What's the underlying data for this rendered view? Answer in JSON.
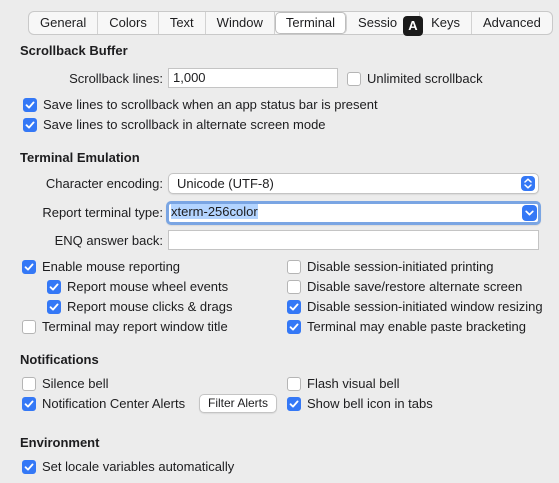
{
  "tabs": [
    "General",
    "Colors",
    "Text",
    "Window",
    "Terminal",
    "Sessio",
    "Keys",
    "Advanced"
  ],
  "active_tab": "Terminal",
  "tab_badge": "A",
  "scrollback": {
    "title": "Scrollback Buffer",
    "lines_label": "Scrollback lines:",
    "lines_value": "1,000",
    "unlimited_label": "Unlimited scrollback",
    "unlimited_checked": false,
    "status_bar_label": "Save lines to scrollback when an app status bar is present",
    "status_bar_checked": true,
    "alternate_label": "Save lines to scrollback in alternate screen mode",
    "alternate_checked": true
  },
  "emulation": {
    "title": "Terminal Emulation",
    "encoding_label": "Character encoding:",
    "encoding_value": "Unicode (UTF-8)",
    "report_type_label": "Report terminal type:",
    "report_type_value": "xterm-256color",
    "enq_label": "ENQ answer back:",
    "enq_value": "",
    "left_checks": [
      {
        "label": "Enable mouse reporting",
        "checked": true
      },
      {
        "label": "Report mouse wheel events",
        "checked": true
      },
      {
        "label": "Report mouse clicks & drags",
        "checked": true
      },
      {
        "label": "Terminal may report window title",
        "checked": false
      }
    ],
    "right_checks": [
      {
        "label": "Disable session-initiated printing",
        "checked": false
      },
      {
        "label": "Disable save/restore alternate screen",
        "checked": false
      },
      {
        "label": "Disable session-initiated window resizing",
        "checked": true
      },
      {
        "label": "Terminal may enable paste bracketing",
        "checked": true
      }
    ]
  },
  "notifications": {
    "title": "Notifications",
    "silence_bell": {
      "label": "Silence bell",
      "checked": false
    },
    "notification_center": {
      "label": "Notification Center Alerts",
      "checked": true
    },
    "filter_alerts_button": "Filter Alerts",
    "flash_visual_bell": {
      "label": "Flash visual bell",
      "checked": false
    },
    "show_bell_icon": {
      "label": "Show bell icon in tabs",
      "checked": true
    }
  },
  "environment": {
    "title": "Environment",
    "set_locale": {
      "label": "Set locale variables automatically",
      "checked": true
    }
  },
  "colors": {
    "accent": "#3478f6",
    "focus_ring": "#7aa5e3",
    "selection": "#b3d4ff"
  }
}
